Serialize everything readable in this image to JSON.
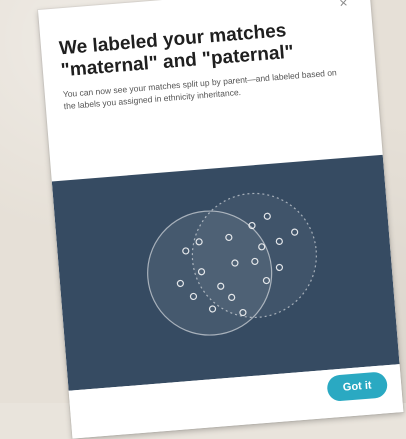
{
  "modal": {
    "title_line1": "We labeled your matches",
    "title_line2": "\"maternal\" and \"paternal\"",
    "description": "You can now see your matches split up by parent—and labeled based on the labels you assigned in ethnicity inheritance.",
    "close_glyph": "×",
    "illustration_icon": "overlapping-circles-icon",
    "button_label": "Got it"
  },
  "colors": {
    "illustration_bg": "#364b62",
    "button": "#2aa9c2"
  }
}
